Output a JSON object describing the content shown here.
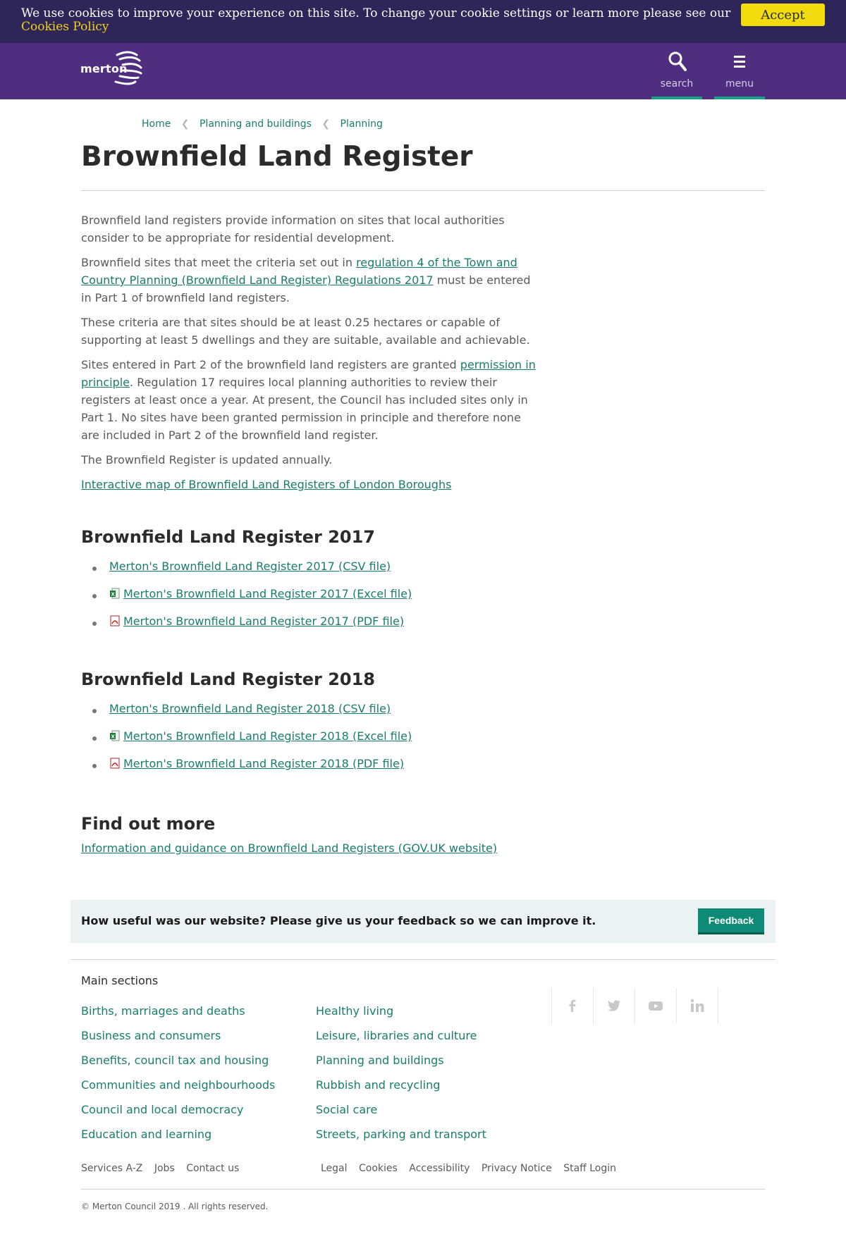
{
  "cookie": {
    "text": "We use cookies to improve your experience on this site. To change your cookie settings or learn more please see our",
    "link": "Cookies Policy",
    "accept": "Accept"
  },
  "header": {
    "logo_text": "merton",
    "search_label": "search",
    "menu_label": "menu"
  },
  "breadcrumb": [
    "Home",
    "Planning and buildings",
    "Planning"
  ],
  "page_title": "Brownfield Land Register",
  "intro": {
    "p1": "Brownfield land registers provide information on sites that local authorities consider to be appropriate for residential development.",
    "p2_before": "Brownfield sites that meet the criteria set out in ",
    "p2_link": "regulation 4 of the Town and Country Planning (Brownfield Land Register) Regulations 2017",
    "p2_after": " must be entered in Part 1 of brownfield land registers.",
    "p3": "These criteria are that sites should be at least 0.25 hectares or capable of supporting at least 5 dwellings and they are suitable, available and achievable.",
    "p4_before": "Sites entered in Part 2 of the brownfield land registers are granted ",
    "p4_link": "permission in principle",
    "p4_after": ". Regulation 17 requires local planning authorities to review their registers at least once a year. At present, the Council has included sites only in Part 1. No sites have been granted permission in principle and therefore none are included in Part 2 of the brownfield land register.",
    "p5": "The Brownfield Register is updated annually.",
    "map_link": "Interactive map of Brownfield Land Registers of London Boroughs"
  },
  "reg2017": {
    "heading": "Brownfield Land Register 2017",
    "csv": "Merton's Brownfield Land Register 2017 (CSV file)",
    "excel": "Merton's Brownfield Land Register 2017 (Excel file)",
    "pdf": "Merton's Brownfield Land Register 2017 (PDF file)"
  },
  "reg2018": {
    "heading": "Brownfield Land Register 2018",
    "csv": "Merton's Brownfield Land Register 2018 (CSV file)",
    "excel": "Merton's Brownfield Land Register 2018 (Excel file)",
    "pdf": "Merton's Brownfield Land Register 2018 (PDF file)"
  },
  "find_out_more": {
    "heading": "Find out more",
    "link": "Information and guidance on Brownfield Land Registers (GOV.UK website)"
  },
  "feedback": {
    "question": "How useful was our website? Please give us your feedback so we can improve it.",
    "button": "Feedback"
  },
  "footer": {
    "main_sections_title": "Main sections",
    "col1": [
      "Births, marriages and deaths",
      "Business and consumers",
      "Benefits, council tax and housing",
      "Communities and neighbourhoods",
      "Council and local democracy",
      "Education and learning"
    ],
    "col2": [
      "Healthy living",
      "Leisure, libraries and culture",
      "Planning and buildings",
      "Rubbish and recycling",
      "Social care",
      "Streets, parking and transport"
    ],
    "links_left": [
      "Services A-Z",
      "Jobs",
      "Contact us"
    ],
    "links_right": [
      "Legal",
      "Cookies",
      "Accessibility",
      "Privacy Notice",
      "Staff Login"
    ],
    "copyright": "© Merton Council 2019 . All rights reserved."
  },
  "colors": {
    "header": "#4f2d7f",
    "cookie_bar": "#2e2558",
    "accent": "#1a7d6c",
    "accept": "#f2dc0d"
  }
}
